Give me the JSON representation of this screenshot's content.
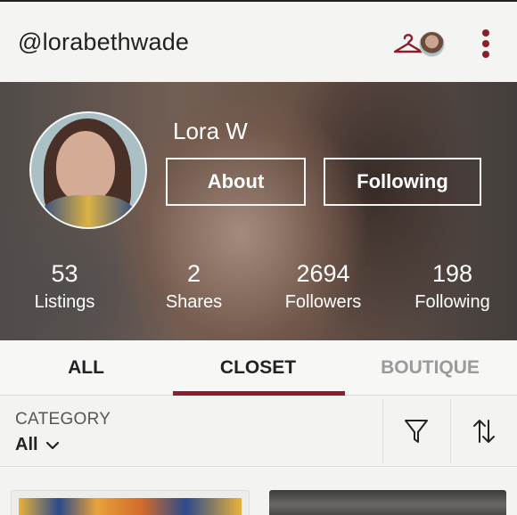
{
  "header": {
    "username": "@lorabethwade"
  },
  "profile": {
    "display_name": "Lora W",
    "about_button": "About",
    "following_button": "Following",
    "stats": [
      {
        "value": "53",
        "label": "Listings"
      },
      {
        "value": "2",
        "label": "Shares"
      },
      {
        "value": "2694",
        "label": "Followers"
      },
      {
        "value": "198",
        "label": "Following"
      }
    ]
  },
  "tabs": [
    {
      "label": "ALL"
    },
    {
      "label": "CLOSET"
    },
    {
      "label": "BOUTIQUE"
    }
  ],
  "active_tab": "CLOSET",
  "filter": {
    "category_label": "CATEGORY",
    "category_value": "All"
  },
  "icons": {
    "hanger": "hanger-icon",
    "menu": "more-vertical-icon",
    "filter": "filter-icon",
    "sort": "sort-icon",
    "dropdown": "chevron-down-icon"
  },
  "colors": {
    "accent": "#8a1e2a",
    "inactive_tab": "#9a9a9a"
  }
}
